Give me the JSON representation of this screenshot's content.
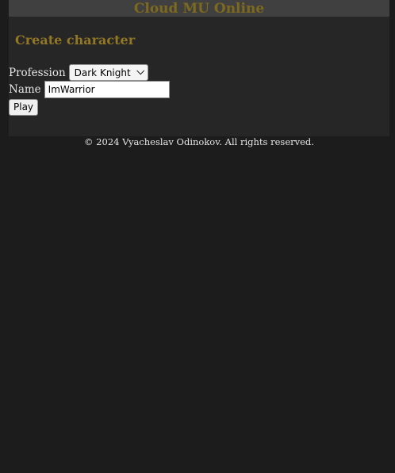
{
  "header": {
    "title": "Cloud MU Online"
  },
  "form": {
    "heading": "Create character",
    "profession_label": "Profession",
    "profession_value": "Dark Knight",
    "name_label": "Name",
    "name_value": "ImWarrior",
    "play_label": "Play"
  },
  "footer": {
    "copyright": "© 2024 Vyacheslav Odinokov. All rights reserved."
  },
  "colors": {
    "page_bg": "#1c1c1c",
    "panel_bg": "#262626",
    "header_bg": "#404040",
    "title_gold": "#7d6a1d",
    "heading_gold": "#927725"
  }
}
